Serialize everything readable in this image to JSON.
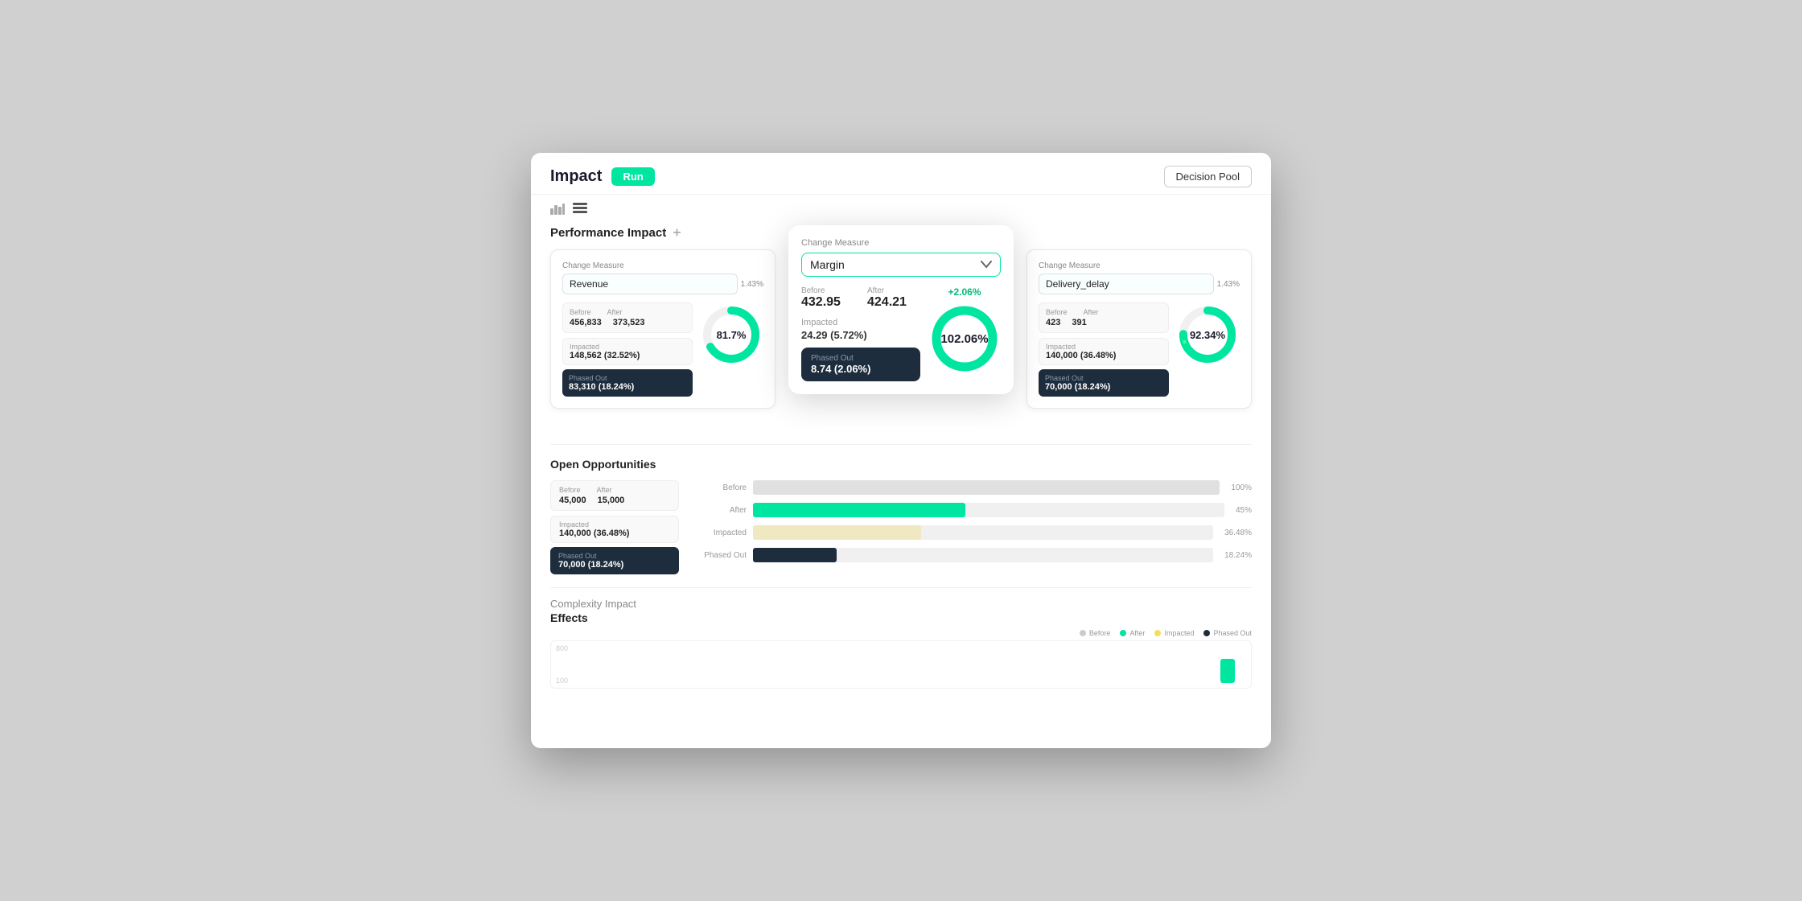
{
  "header": {
    "title": "Impact",
    "run_label": "Run",
    "decision_pool_label": "Decision Pool"
  },
  "toolbar": {
    "icon1": "bar-chart-icon",
    "icon2": "list-icon"
  },
  "performance_impact": {
    "section_title": "Performance Impact",
    "add_label": "+",
    "cards": [
      {
        "change_measure_label": "Change Measure",
        "measure": "Revenue",
        "percent": "1.43%",
        "before_label": "Before",
        "after_label": "After",
        "before_value": "456,833",
        "after_value": "373,523",
        "impacted_label": "Impacted",
        "impacted_value": "148,562 (32.52%)",
        "phased_out_label": "Phased Out",
        "phased_out_value": "83,310 (18.24%)",
        "donut_percent": "81.7%",
        "donut_main": 81.7,
        "donut_color": "#00e5a0"
      },
      {
        "change_measure_label": "Change Measure",
        "measure": "Margin",
        "center_badge": "+2.06%",
        "before_label": "Before",
        "after_label": "After",
        "before_value": "432.95",
        "after_value": "424.21",
        "impacted_label": "Impacted",
        "impacted_value": "24.29 (5.72%)",
        "phased_out_label": "Phased Out",
        "phased_out_value": "8.74 (2.06%)",
        "donut_percent": "102.06%",
        "donut_main": 100,
        "donut_color": "#00e5a0"
      },
      {
        "change_measure_label": "Change Measure",
        "measure": "Delivery_delay",
        "percent": "1.43%",
        "before_label": "Before",
        "after_label": "After",
        "before_value": "423",
        "after_value": "391",
        "impacted_label": "Impacted",
        "impacted_value": "140,000 (36.48%)",
        "phased_out_label": "Phased Out",
        "phased_out_value": "70,000 (18.24%)",
        "donut_percent": "92.34%",
        "donut_main": 92.34,
        "donut_color": "#00e5a0"
      }
    ]
  },
  "open_opportunities": {
    "title": "Open Opportunities",
    "before_label": "Before",
    "after_label": "After",
    "before_value": "45,000",
    "after_value": "15,000",
    "impacted_label": "Impacted",
    "impacted_value": "140,000 (36.48%)",
    "phased_out_label": "Phased Out",
    "phased_out_value": "70,000 (18.24%)",
    "bars": [
      {
        "label": "Before",
        "pct": 100,
        "color": "#e0e0e0",
        "pct_label": "100%"
      },
      {
        "label": "After",
        "pct": 45,
        "color": "#00e5a0",
        "pct_label": "45%"
      },
      {
        "label": "Impacted",
        "pct": 36.48,
        "color": "#f0e8c0",
        "pct_label": "36.48%"
      },
      {
        "label": "Phased Out",
        "pct": 18.24,
        "color": "#1e2d3d",
        "pct_label": "18.24%"
      }
    ]
  },
  "complexity_impact": {
    "title": "Complexity Impact",
    "subtitle": "Effects",
    "legend": [
      {
        "label": "Before",
        "color": "#cccccc"
      },
      {
        "label": "After",
        "color": "#00e5a0"
      },
      {
        "label": "Impacted",
        "color": "#f0e060"
      },
      {
        "label": "Phased Out",
        "color": "#1e2d3d"
      }
    ],
    "y_top": "800",
    "y_bottom": "100"
  }
}
